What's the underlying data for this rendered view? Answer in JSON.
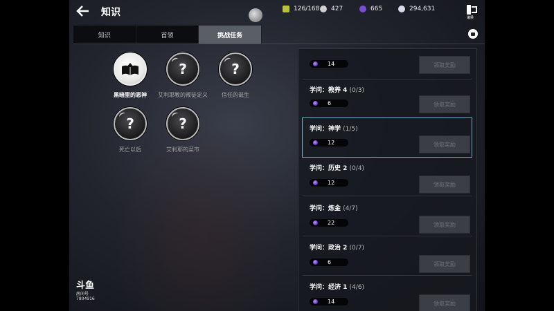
{
  "header": {
    "title": "知识",
    "resources": [
      {
        "icon": "supply-icon",
        "value": "126/168",
        "color": "#b8c23a"
      },
      {
        "icon": "silver-coin-icon",
        "value": "427",
        "color": "#cfcfcf"
      },
      {
        "icon": "purple-gem-icon",
        "value": "665",
        "color": "#7d4cd6"
      },
      {
        "icon": "crystal-coin-icon",
        "value": "294,631",
        "color": "#d6dbe8"
      }
    ],
    "logo_caption": "诸侯"
  },
  "tabs": [
    {
      "label": "知识",
      "active": false
    },
    {
      "label": "首领",
      "active": false
    },
    {
      "label": "挑战任务",
      "active": true
    }
  ],
  "knowledge": [
    {
      "label": "黑暗里的恶神",
      "unlocked": true
    },
    {
      "label": "艾利耶教的叛徒定义",
      "unlocked": false,
      "glyph": "?"
    },
    {
      "label": "信任的诞生",
      "unlocked": false,
      "glyph": "?"
    },
    {
      "label": "死亡以后",
      "unlocked": false,
      "glyph": "?"
    },
    {
      "label": "艾利耶的菜市",
      "unlocked": false,
      "glyph": "?"
    }
  ],
  "watermark": {
    "logo": "斗鱼",
    "room": "房间号",
    "id": "7804916"
  },
  "tasks": [
    {
      "title": "",
      "progress": "",
      "reward": "14",
      "button": "领取奖励",
      "selected": false
    },
    {
      "title": "学问：教养 4",
      "progress": "(0/3)",
      "reward": "6",
      "button": "领取奖励",
      "selected": false
    },
    {
      "title": "学问：神学",
      "progress": "(1/5)",
      "reward": "12",
      "button": "领取奖励",
      "selected": true
    },
    {
      "title": "学问：历史 2",
      "progress": "(0/4)",
      "reward": "12",
      "button": "领取奖励",
      "selected": false
    },
    {
      "title": "学问：炼金",
      "progress": "(4/7)",
      "reward": "22",
      "button": "领取奖励",
      "selected": false
    },
    {
      "title": "学问：政治 2",
      "progress": "(0/7)",
      "reward": "6",
      "button": "领取奖励",
      "selected": false
    },
    {
      "title": "学问：经济 1",
      "progress": "(4/6)",
      "reward": "14",
      "button": "领取奖励",
      "selected": false
    }
  ]
}
